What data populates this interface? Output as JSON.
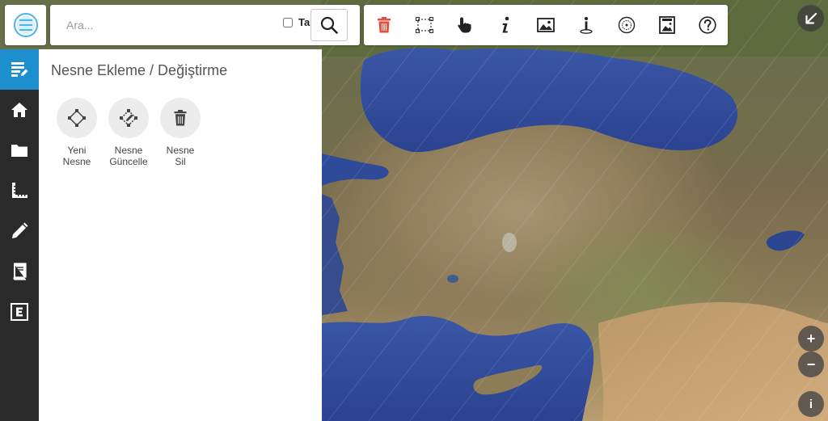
{
  "search": {
    "placeholder": "Ara...",
    "full_match_label": "Tam"
  },
  "toolbar": {
    "tools": [
      {
        "icon": "trash-icon",
        "color": "#e84c3d"
      },
      {
        "icon": "select-area-icon"
      },
      {
        "icon": "hand-pointer-icon"
      },
      {
        "icon": "info-icon"
      },
      {
        "icon": "image-icon"
      },
      {
        "icon": "location-info-icon"
      },
      {
        "icon": "coordinate-icon"
      },
      {
        "icon": "map-image-icon"
      },
      {
        "icon": "help-icon"
      }
    ]
  },
  "sidebar": {
    "items": [
      {
        "icon": "edit-list-icon",
        "active": true
      },
      {
        "icon": "home-icon"
      },
      {
        "icon": "folder-icon"
      },
      {
        "icon": "ruler-icon"
      },
      {
        "icon": "pencil-icon"
      },
      {
        "icon": "book-icon"
      },
      {
        "icon": "e-square-icon"
      }
    ]
  },
  "panel": {
    "title": "Nesne Ekleme / Değiştirme",
    "actions": [
      {
        "line1": "Yeni",
        "line2": "Nesne"
      },
      {
        "line1": "Nesne",
        "line2": "Güncelle"
      },
      {
        "line1": "Nesne",
        "line2": "Sil"
      }
    ]
  },
  "map_controls": {
    "zoom_in": "+",
    "zoom_out": "−",
    "info": "i"
  },
  "colors": {
    "accent": "#1d8fce",
    "sidebar": "#2a2a2a",
    "delete": "#e84c3d"
  }
}
